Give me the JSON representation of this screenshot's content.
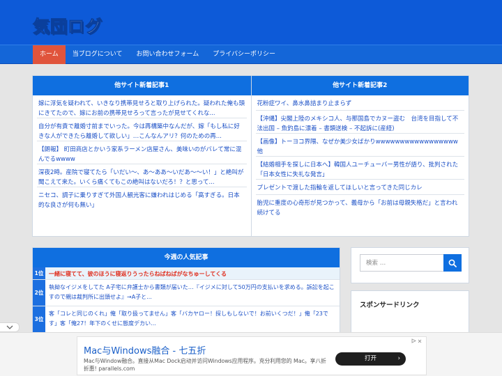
{
  "site": {
    "logo_text": "気団ログ"
  },
  "nav": {
    "items": [
      {
        "label": "ホーム"
      },
      {
        "label": "当ブログについて"
      },
      {
        "label": "お問い合わせフォーム"
      },
      {
        "label": "プライバシーポリシー"
      }
    ]
  },
  "feeds": [
    {
      "title": "他サイト新着記事1",
      "items": [
        {
          "text": "嫁に浮気を疑われて、いきなり携帯見せろと取り上げられた。疑われた俺も頭にきてたので、嫁にお前の携帯見せろって言ったが見せてくれな..."
        },
        {
          "text": "自分が有責で離婚寸前までいった。今は再構築中なんだが、嫁「もし私に好きな人ができたら離婚して欲しい」…こんなんアリ？何のための再..."
        },
        {
          "text": "【朗報】 町田商店とかいう家系ラーメン店屋さん、美味いのがバレて常に混んでるwwww"
        },
        {
          "text": "深夜2時。産院で寝てたら「いだい〜、あ〜ああ〜いだあ〜〜い！」と絶叫が聞こえて来た。いくら痛くてもこの絶叫はないだろ！？と思って..."
        },
        {
          "text": "ニセコ、調子に乗りすぎて外国人観光客に嫌われはじめる「高すぎる。日本的な良さが何も無い」"
        }
      ]
    },
    {
      "title": "他サイト新着記事2",
      "items": [
        {
          "text": "花粉症ワイ、鼻水鼻詰まり止まらず"
        },
        {
          "text": "【沖縄】尖閣上陸のメキシコ人、与那国島でカヌー盗む　台湾を目指して不法出国 – 魚釣島に漂着 – 書類送検 – 不起訴に(産経)"
        },
        {
          "text": "【画像】トーヨコ界隈、なぜか美少女ばかりwwwwwwwwwwwwwwwww他"
        },
        {
          "text": "【結婚相手を探しに日本へ】韓国人ユーチューバー男性が語り、批判された「日本女性に失礼な発言」"
        },
        {
          "text": "プレゼントで渡した指輪を返してほしいと言ってきた同じカレ"
        },
        {
          "text": "胎児に重度の心奇形が見つかって、義母から「お前は母親失格だ」と言われ続けてる"
        }
      ]
    }
  ],
  "popular": {
    "title": "今週の人気記事",
    "items": [
      {
        "rank": "1位",
        "text": "一緒に寝てて、彼のほうに寝返りうったらねばねばがなちゅーしてくる"
      },
      {
        "rank": "2位",
        "text": "執拗なイジメをしてた A子宅に弁護士から書類が届いた…『イジメに対して50万円の支払いを求める。訴訟を起こすので親は裁判所に出頭せよ』→A子と..."
      },
      {
        "rank": "3位",
        "text": "客「コレと同じのくれ」俺「取り扱ってません」客「バカヤロー！探しもしないで！お前いくつだ！」俺「23です」客「俺27！年下のくせに態度デカい..."
      }
    ]
  },
  "search": {
    "placeholder": "検索 …",
    "button_icon": "search-icon"
  },
  "sponsor": {
    "title": "スポンサードリンク"
  },
  "ad": {
    "title": "Mac与Windows融合 - 七五折",
    "description": "Mac与Window融合。直接从Mac Dock启动并访问Windows应用程序。充分利用您的 Mac。享八折折惠! parallels.com",
    "button_label": "打开",
    "badge_icon": "adchoices-icon",
    "close_icon": "close-icon"
  },
  "colors": {
    "header": "#0d5ad8",
    "nav": "#1466d8",
    "nav_active": "#e0543c",
    "link": "#1a4fc6",
    "accent": "#0f6fe0",
    "rank1_text": "#e03020"
  }
}
